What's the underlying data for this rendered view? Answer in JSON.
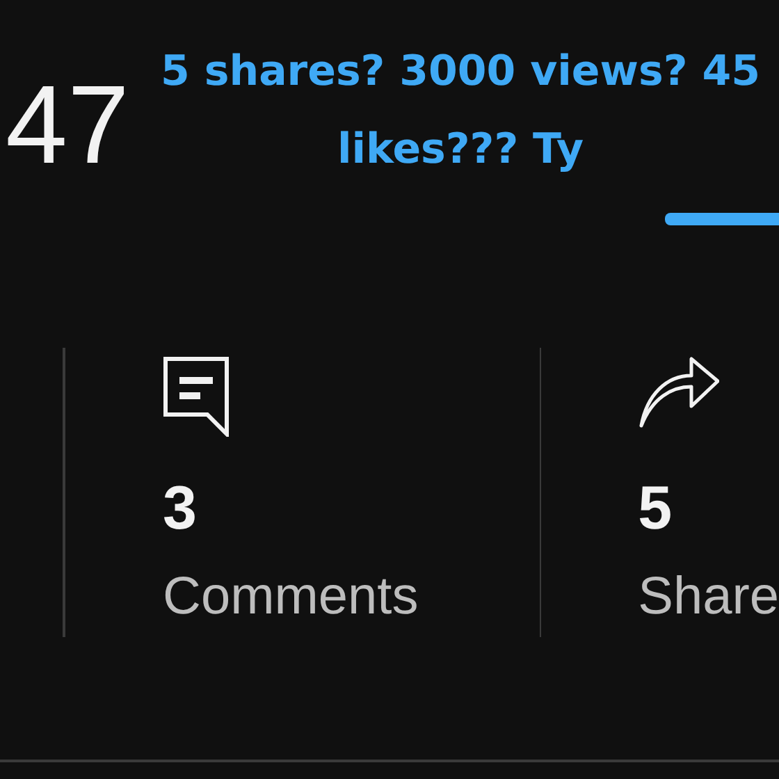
{
  "count": "47",
  "caption": "5 shares? 3000 views? 45 likes??? Ty",
  "stats": [
    {
      "kind": "comments",
      "value": "3",
      "label": "Comments"
    },
    {
      "kind": "shares",
      "value": "5",
      "label": "Share"
    }
  ]
}
